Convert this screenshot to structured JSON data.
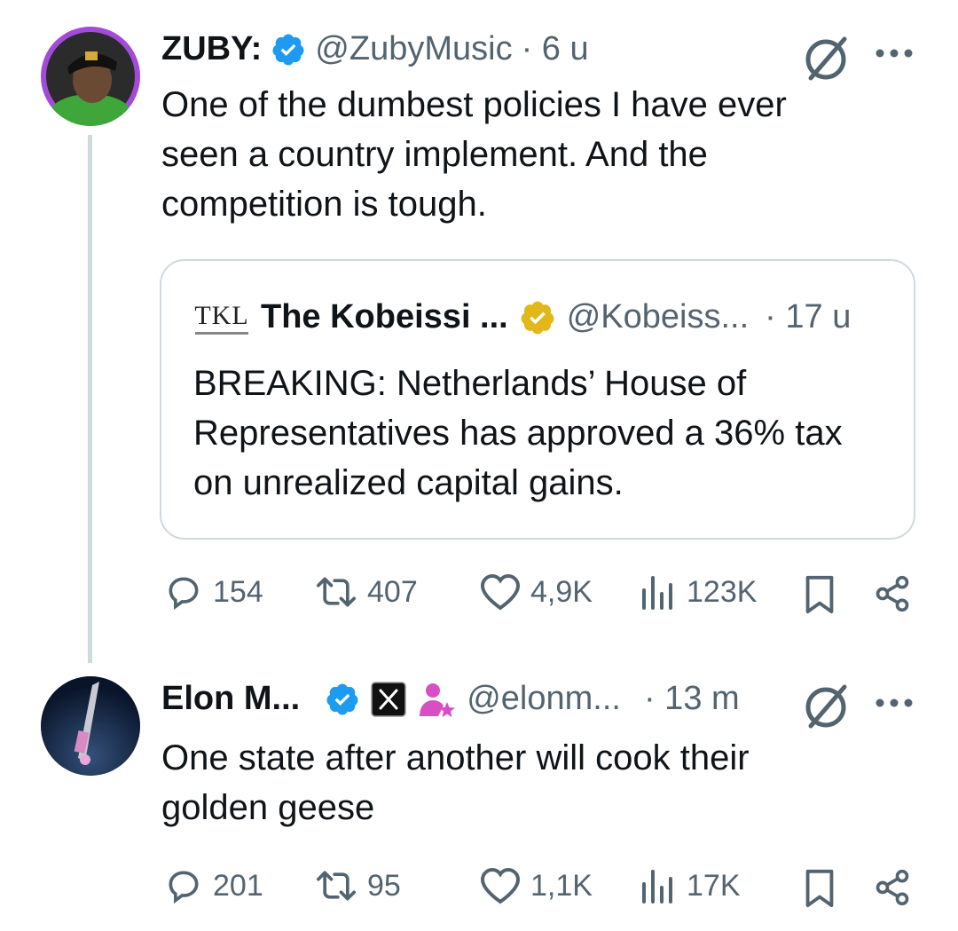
{
  "tweet1": {
    "name": "ZUBY:",
    "handle": "@ZubyMusic",
    "time": "· 6 u",
    "text_lines": [
      "One of the dumbest policies I have ever",
      "seen a country implement. And the",
      "competition is tough."
    ],
    "quote": {
      "logo_text": "TKL",
      "name": "The Kobeissi ...",
      "handle": "@Kobeiss...",
      "time": "· 17 u",
      "text_lines": [
        "BREAKING: Netherlands’ House of",
        "Representatives has approved a 36% tax",
        "on unrealized capital gains."
      ]
    },
    "stats": {
      "replies": "154",
      "reposts": "407",
      "likes": "4,9K",
      "views": "123K"
    }
  },
  "tweet2": {
    "name": "Elon M...",
    "handle": "@elonm...",
    "time": "· 13 m",
    "text_lines": [
      "One state after another will cook their",
      "golden geese"
    ],
    "stats": {
      "replies": "201",
      "reposts": "95",
      "likes": "1,1K",
      "views": "17K"
    }
  },
  "colors": {
    "verified_blue": "#1d9bf0",
    "verified_gold": "#e2b719",
    "secondary_text": "#536471",
    "avatar_ring": "#a34ad8"
  }
}
